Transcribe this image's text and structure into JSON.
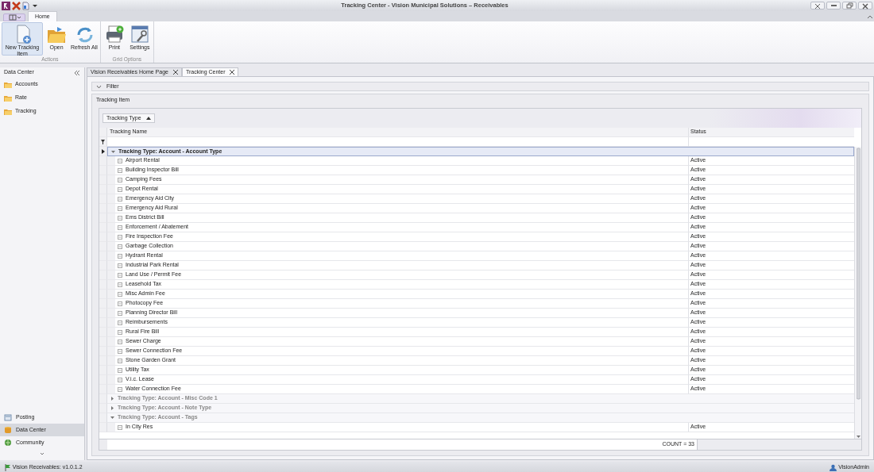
{
  "window": {
    "title": "Tracking Center - Vision Municipal Solutions – Receivables"
  },
  "ribbon": {
    "tabs": [
      {
        "label": "Home",
        "selected": true
      }
    ],
    "groups": [
      {
        "label": "Actions",
        "buttons": [
          {
            "label": "New Tracking Item",
            "kind": "new",
            "highlighted": true
          },
          {
            "label": "Open",
            "kind": "open",
            "highlighted": false
          },
          {
            "label": "Refresh All",
            "kind": "refresh",
            "highlighted": false
          }
        ]
      },
      {
        "label": "Grid Options",
        "buttons": [
          {
            "label": "Print",
            "kind": "print",
            "highlighted": false
          },
          {
            "label": "Settings",
            "kind": "settings",
            "highlighted": false
          }
        ]
      }
    ]
  },
  "sidebar": {
    "title": "Data Center",
    "items": [
      {
        "label": "Accounts"
      },
      {
        "label": "Rate"
      },
      {
        "label": "Tracking"
      }
    ],
    "nav_buttons": [
      {
        "label": "Posting",
        "kind": "posting",
        "selected": false
      },
      {
        "label": "Data Center",
        "kind": "data",
        "selected": true
      },
      {
        "label": "Community",
        "kind": "community",
        "selected": false
      }
    ]
  },
  "document_tabs": [
    {
      "label": "Vision Receivables Home Page",
      "selected": false
    },
    {
      "label": "Tracking Center",
      "selected": true
    }
  ],
  "filter_panel": {
    "title": "Filter",
    "expanded": false
  },
  "panel_title": "Tracking Item",
  "grid": {
    "group_by": "Tracking Type",
    "columns": [
      "Tracking Name",
      "Status"
    ],
    "groups": [
      {
        "title": "Tracking Type: Account - Account Type",
        "expanded": true,
        "selected": true,
        "rows": [
          {
            "name": "Airport Rental",
            "status": "Active"
          },
          {
            "name": "Building Inspector Bill",
            "status": "Active"
          },
          {
            "name": "Camping Fees",
            "status": "Active"
          },
          {
            "name": "Depot Rental",
            "status": "Active"
          },
          {
            "name": "Emergency Aid City",
            "status": "Active"
          },
          {
            "name": "Emergency Aid Rural",
            "status": "Active"
          },
          {
            "name": "Ems District Bill",
            "status": "Active"
          },
          {
            "name": "Enforcement / Abatement",
            "status": "Active"
          },
          {
            "name": "Fire Inspection Fee",
            "status": "Active"
          },
          {
            "name": "Garbage Collection",
            "status": "Active"
          },
          {
            "name": "Hydrant Rental",
            "status": "Active"
          },
          {
            "name": "Industrial Park Rental",
            "status": "Active"
          },
          {
            "name": "Land Use / Permit Fee",
            "status": "Active"
          },
          {
            "name": "Leasehold Tax",
            "status": "Active"
          },
          {
            "name": "Misc Admin Fee",
            "status": "Active"
          },
          {
            "name": "Photocopy Fee",
            "status": "Active"
          },
          {
            "name": "Planning Director Bill",
            "status": "Active"
          },
          {
            "name": "Reimbursements",
            "status": "Active"
          },
          {
            "name": "Rural Fire Bill",
            "status": "Active"
          },
          {
            "name": "Sewer Charge",
            "status": "Active"
          },
          {
            "name": "Sewer Connection Fee",
            "status": "Active"
          },
          {
            "name": "Stone Garden Grant",
            "status": "Active"
          },
          {
            "name": "Utility Tax",
            "status": "Active"
          },
          {
            "name": "V.i.c. Lease",
            "status": "Active"
          },
          {
            "name": "Water Connection Fee",
            "status": "Active"
          }
        ]
      },
      {
        "title": "Tracking Type: Account - Misc Code 1",
        "expanded": false,
        "selected": false
      },
      {
        "title": "Tracking Type: Account - Note Type",
        "expanded": false,
        "selected": false
      },
      {
        "title": "Tracking Type: Account - Tags",
        "expanded": true,
        "selected": false,
        "rows": [
          {
            "name": "In City Res",
            "status": "Active"
          }
        ]
      }
    ],
    "footer": "COUNT = 33"
  },
  "status_bar": {
    "version": "Vision Receivables: v1.0.1.2",
    "user": "VisionAdmin"
  }
}
